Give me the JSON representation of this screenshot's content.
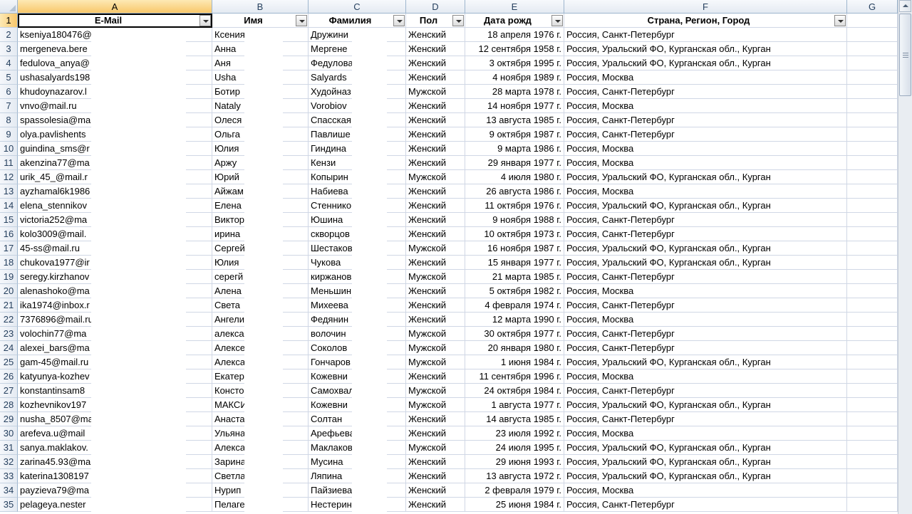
{
  "columns": [
    "A",
    "B",
    "C",
    "D",
    "E",
    "F",
    "G"
  ],
  "header_row_number": "1",
  "headers": [
    "E-Mail",
    "Имя",
    "Фамилия",
    "Пол",
    "Дата рожд",
    "Страна, Регион, Город"
  ],
  "rows": [
    {
      "n": "2",
      "email": "kseniya180476@",
      "name": "Ксения",
      "surname": "Дружини",
      "gender": "Женский",
      "dob": "18 апреля 1976 г.",
      "location": "Россия, Санкт-Петербург"
    },
    {
      "n": "3",
      "email": "mergeneva.bere",
      "name": "Анна",
      "surname": "Мергене",
      "gender": "Женский",
      "dob": "12 сентября 1958 г.",
      "location": "Россия, Уральский ФО, Курганская обл., Курган"
    },
    {
      "n": "4",
      "email": "fedulova_anya@",
      "name": "Аня",
      "surname": "Федулова",
      "gender": "Женский",
      "dob": "3 октября 1995 г.",
      "location": "Россия, Уральский ФО, Курганская обл., Курган"
    },
    {
      "n": "5",
      "email": "ushasalyards198",
      "name": "Usha",
      "surname": "Salyards",
      "gender": "Женский",
      "dob": "4 ноября 1989 г.",
      "location": "Россия, Москва"
    },
    {
      "n": "6",
      "email": "khudoynazarov.l",
      "name": "Ботир",
      "surname": "Худойназ",
      "gender": "Мужской",
      "dob": "28 марта 1978 г.",
      "location": "Россия, Санкт-Петербург"
    },
    {
      "n": "7",
      "email": "vnvo@mail.ru",
      "name": "Nataly",
      "surname": "Vorobiov",
      "gender": "Женский",
      "dob": "14 ноября 1977 г.",
      "location": "Россия, Москва"
    },
    {
      "n": "8",
      "email": "spassolesia@ma",
      "name": "Олеся",
      "surname": "Спасская",
      "gender": "Женский",
      "dob": "13 августа 1985 г.",
      "location": "Россия, Санкт-Петербург"
    },
    {
      "n": "9",
      "email": "olya.pavlishents",
      "name": "Ольга",
      "surname": "Павлише",
      "gender": "Женский",
      "dob": "9 октября 1987 г.",
      "location": "Россия, Санкт-Петербург"
    },
    {
      "n": "10",
      "email": "guindina_sms@r",
      "name": "Юлия",
      "surname": "Гиндина",
      "gender": "Женский",
      "dob": "9 марта 1986 г.",
      "location": "Россия, Москва"
    },
    {
      "n": "11",
      "email": "akenzina77@ma",
      "name": "Аржу",
      "surname": "Кензи",
      "gender": "Женский",
      "dob": "29 января 1977 г.",
      "location": "Россия, Москва"
    },
    {
      "n": "12",
      "email": "urik_45_@mail.r",
      "name": "Юрий",
      "surname": "Копырин",
      "gender": "Мужской",
      "dob": "4 июля 1980 г.",
      "location": "Россия, Уральский ФО, Курганская обл., Курган"
    },
    {
      "n": "13",
      "email": "ayzhamal6k1986",
      "name": "Айжам",
      "surname": "Набиева",
      "gender": "Женский",
      "dob": "26 августа 1986 г.",
      "location": "Россия, Москва"
    },
    {
      "n": "14",
      "email": "elena_stennikov",
      "name": "Елена",
      "surname": "Стеннико",
      "gender": "Женский",
      "dob": "11 октября 1976 г.",
      "location": "Россия, Уральский ФО, Курганская обл., Курган"
    },
    {
      "n": "15",
      "email": "victoria252@ma",
      "name": "Виктор",
      "surname": "Юшина",
      "gender": "Женский",
      "dob": "9 ноября 1988 г.",
      "location": "Россия, Санкт-Петербург"
    },
    {
      "n": "16",
      "email": "kolo3009@mail.",
      "name": "ирина",
      "surname": "скворцов",
      "gender": "Женский",
      "dob": "10 октября 1973 г.",
      "location": "Россия, Санкт-Петербург"
    },
    {
      "n": "17",
      "email": "45-ss@mail.ru",
      "name": "Сергей",
      "surname": "Шестаков",
      "gender": "Мужской",
      "dob": "16 ноября 1987 г.",
      "location": "Россия, Уральский ФО, Курганская обл., Курган"
    },
    {
      "n": "18",
      "email": "chukova1977@ir",
      "name": "Юлия",
      "surname": "Чукова",
      "gender": "Женский",
      "dob": "15 января 1977 г.",
      "location": "Россия, Уральский ФО, Курганская обл., Курган"
    },
    {
      "n": "19",
      "email": "seregy.kirzhanov",
      "name": "серегй",
      "surname": "киржанов",
      "gender": "Мужской",
      "dob": "21 марта 1985 г.",
      "location": "Россия, Санкт-Петербург"
    },
    {
      "n": "20",
      "email": "alenashoko@ma",
      "name": "Алена",
      "surname": "Меньшин",
      "gender": "Женский",
      "dob": "5 октября 1982 г.",
      "location": "Россия, Москва"
    },
    {
      "n": "21",
      "email": "ika1974@inbox.r",
      "name": "Света",
      "surname": "Михеева",
      "gender": "Женский",
      "dob": "4 февраля 1974 г.",
      "location": "Россия, Санкт-Петербург"
    },
    {
      "n": "22",
      "email": "7376896@mail.ru",
      "name": "Ангели",
      "surname": "Федянин",
      "gender": "Женский",
      "dob": "12 марта 1990 г.",
      "location": "Россия, Москва"
    },
    {
      "n": "23",
      "email": "volochin77@ma",
      "name": "алекса",
      "surname": "волочин",
      "gender": "Мужской",
      "dob": "30 октября 1977 г.",
      "location": "Россия, Санкт-Петербург"
    },
    {
      "n": "24",
      "email": "alexei_bars@ma",
      "name": "Алексе",
      "surname": "Соколов",
      "gender": "Мужской",
      "dob": "20 января 1980 г.",
      "location": "Россия, Санкт-Петербург"
    },
    {
      "n": "25",
      "email": "gam-45@mail.ru",
      "name": "Алекса",
      "surname": "Гончаров",
      "gender": "Мужской",
      "dob": "1 июня 1984 г.",
      "location": "Россия, Уральский ФО, Курганская обл., Курган"
    },
    {
      "n": "26",
      "email": "katyunya-kozhev",
      "name": "Екатер",
      "surname": "Кожевни",
      "gender": "Женский",
      "dob": "11 сентября 1996 г.",
      "location": "Россия, Москва"
    },
    {
      "n": "27",
      "email": "konstantinsam8",
      "name": "Консто",
      "surname": "Самохвал",
      "gender": "Мужской",
      "dob": "24 октября 1984 г.",
      "location": "Россия, Санкт-Петербург"
    },
    {
      "n": "28",
      "email": "kozhevnikov197",
      "name": "МАКСИ",
      "surname": "Кожевни",
      "gender": "Мужской",
      "dob": "1 августа 1977 г.",
      "location": "Россия, Уральский ФО, Курганская обл., Курган"
    },
    {
      "n": "29",
      "email": "nusha_8507@ma",
      "name": "Анаста",
      "surname": "Солтан",
      "gender": "Женский",
      "dob": "14 августа 1985 г.",
      "location": "Россия, Санкт-Петербург"
    },
    {
      "n": "30",
      "email": "arefeva.u@mail",
      "name": "Ульяна",
      "surname": "Арефьева",
      "gender": "Женский",
      "dob": "23 июля 1992 г.",
      "location": "Россия, Москва"
    },
    {
      "n": "31",
      "email": "sanya.maklakov.",
      "name": "Алекса",
      "surname": "Маклаков",
      "gender": "Мужской",
      "dob": "24 июля 1995 г.",
      "location": "Россия, Уральский ФО, Курганская обл., Курган"
    },
    {
      "n": "32",
      "email": "zarina45.93@ma",
      "name": "Зарина",
      "surname": "Мусина",
      "gender": "Женский",
      "dob": "29 июня 1993 г.",
      "location": "Россия, Уральский ФО, Курганская обл., Курган"
    },
    {
      "n": "33",
      "email": "katerina1308197",
      "name": "Светла",
      "surname": "Ляпина",
      "gender": "Женский",
      "dob": "13 августа 1972 г.",
      "location": "Россия, Уральский ФО, Курганская обл., Курган"
    },
    {
      "n": "34",
      "email": "payzieva79@ma",
      "name": "Нурип",
      "surname": "Пайзиева",
      "gender": "Женский",
      "dob": "2 февраля 1979 г.",
      "location": "Россия, Москва"
    },
    {
      "n": "35",
      "email": "pelageya.nester",
      "name": "Пелаге",
      "surname": "Нестерин",
      "gender": "Женский",
      "dob": "25 июня 1984 г.",
      "location": "Россия, Санкт-Петербург"
    }
  ],
  "icons": {
    "filter": "filter-dropdown-icon",
    "scroll_up": "arrow-up-icon",
    "select_all": "select-all-icon"
  }
}
